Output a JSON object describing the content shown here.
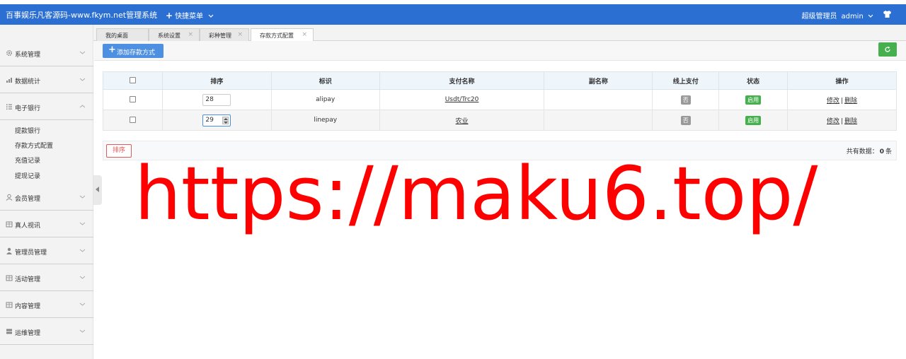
{
  "topbar": {
    "title": "百事娱乐凡客源码-www.fkym.net管理系统",
    "quick_menu": "快捷菜单",
    "role": "超级管理员",
    "username": "admin",
    "theme_icon": "tshirt-icon"
  },
  "sidebar": {
    "items": [
      {
        "label": "系统管理",
        "icon": "gear-icon",
        "expanded": false
      },
      {
        "label": "数据统计",
        "icon": "bar-chart-icon",
        "expanded": false
      },
      {
        "label": "电子银行",
        "icon": "list-icon",
        "expanded": true
      },
      {
        "label": "会员管理",
        "icon": "user-icon",
        "expanded": false
      },
      {
        "label": "真人视讯",
        "icon": "grid-icon",
        "expanded": false
      },
      {
        "label": "管理员管理",
        "icon": "person-icon",
        "expanded": false
      },
      {
        "label": "活动管理",
        "icon": "grid-icon",
        "expanded": false
      },
      {
        "label": "内容管理",
        "icon": "grid-icon",
        "expanded": false
      },
      {
        "label": "运维管理",
        "icon": "server-icon",
        "expanded": false
      }
    ],
    "subitems": [
      "提款银行",
      "存款方式配置",
      "充值记录",
      "提现记录"
    ]
  },
  "tabs": [
    {
      "label": "我的桌面",
      "closable": false
    },
    {
      "label": "系统设置",
      "closable": true
    },
    {
      "label": "彩种管理",
      "closable": true
    },
    {
      "label": "存款方式配置",
      "closable": true,
      "active": true
    }
  ],
  "toolbar": {
    "add_label": "添加存款方式"
  },
  "table": {
    "headers": [
      "",
      "排序",
      "标识",
      "支付名称",
      "副名称",
      "线上支付",
      "状态",
      "操作"
    ],
    "rows": [
      {
        "sort": "28",
        "code": "alipay",
        "name": "Usdt/Trc20",
        "alias": "",
        "online": "否",
        "status": "启用",
        "edit": "修改",
        "delete": "删除"
      },
      {
        "sort": "29",
        "code": "linepay",
        "name": "农业",
        "alias": "",
        "online": "否",
        "status": "启用",
        "edit": "修改",
        "delete": "删除"
      }
    ]
  },
  "footer": {
    "sort_button": "排序",
    "total_prefix": "共有数据：",
    "total_count": "0",
    "total_suffix": "条"
  },
  "watermark": "https://maku6.top/",
  "colors": {
    "topbar": "#2a6fd1",
    "primary_button": "#4d8fe0",
    "success": "#46b04f",
    "danger": "#e05a5a",
    "watermark": "#ff0000"
  }
}
